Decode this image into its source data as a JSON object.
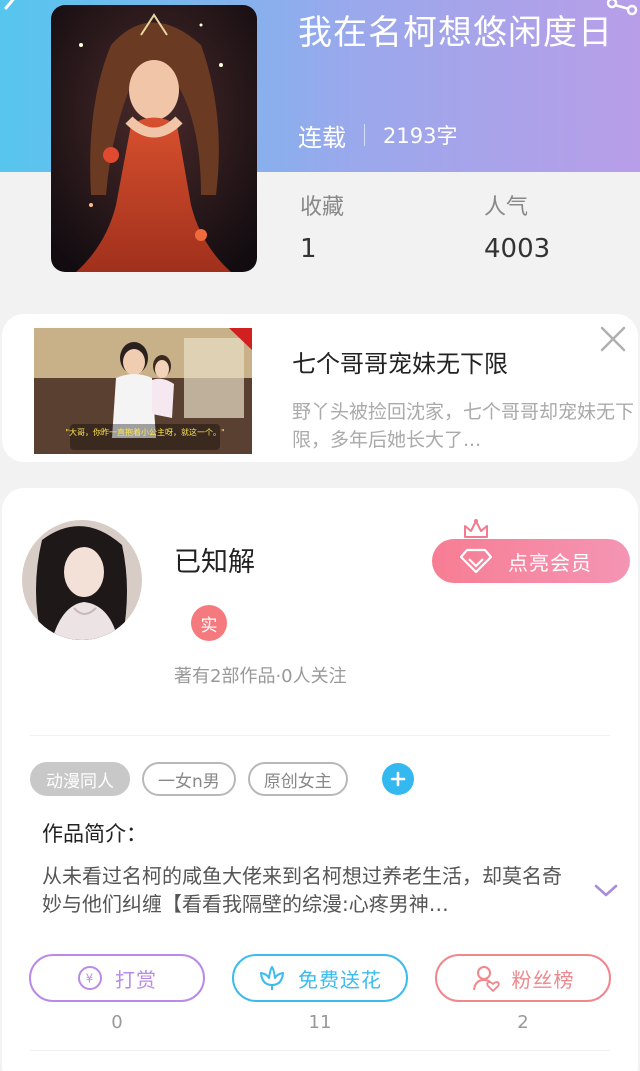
{
  "book": {
    "title": "我在名柯想悠闲度日",
    "status": "连载",
    "word_count": "2193字",
    "stats": [
      {
        "label": "收藏",
        "value": "1"
      },
      {
        "label": "人气",
        "value": "4003"
      }
    ]
  },
  "ad": {
    "title": "七个哥哥宠妹无下限",
    "description": "野丫头被捡回沈家，七个哥哥却宠妹无下限，多年后她长大了...",
    "image_caption": "\"大哥，你昨一直抱着小公主呀，就这一个。\"",
    "close_icon": "close-icon"
  },
  "author": {
    "name": "已知解",
    "badge": "实",
    "stats": "著有2部作品·0人关注",
    "vip_button": "点亮会员"
  },
  "tags": [
    "动漫同人",
    "一女n男",
    "原创女主"
  ],
  "intro": {
    "label": "作品简介：",
    "text": "从未看过名柯的咸鱼大佬来到名柯想过养老生活，却莫名奇妙与他们纠缠【看看我隔壁的综漫:心疼男神…"
  },
  "actions": [
    {
      "label": "打赏",
      "count": "0",
      "icon": "yen-coin-icon",
      "color": "#b98be6"
    },
    {
      "label": "免费送花",
      "count": "11",
      "icon": "flower-icon",
      "color": "#3cbcec"
    },
    {
      "label": "粉丝榜",
      "count": "2",
      "icon": "fan-user-icon",
      "color": "#f0878d"
    }
  ],
  "colors": {
    "header_gradient": [
      "#56c6ee",
      "#b89ee8"
    ],
    "vip_gradient": [
      "#f77d93",
      "#f495b4"
    ],
    "tag_add": "#34b8f0"
  }
}
